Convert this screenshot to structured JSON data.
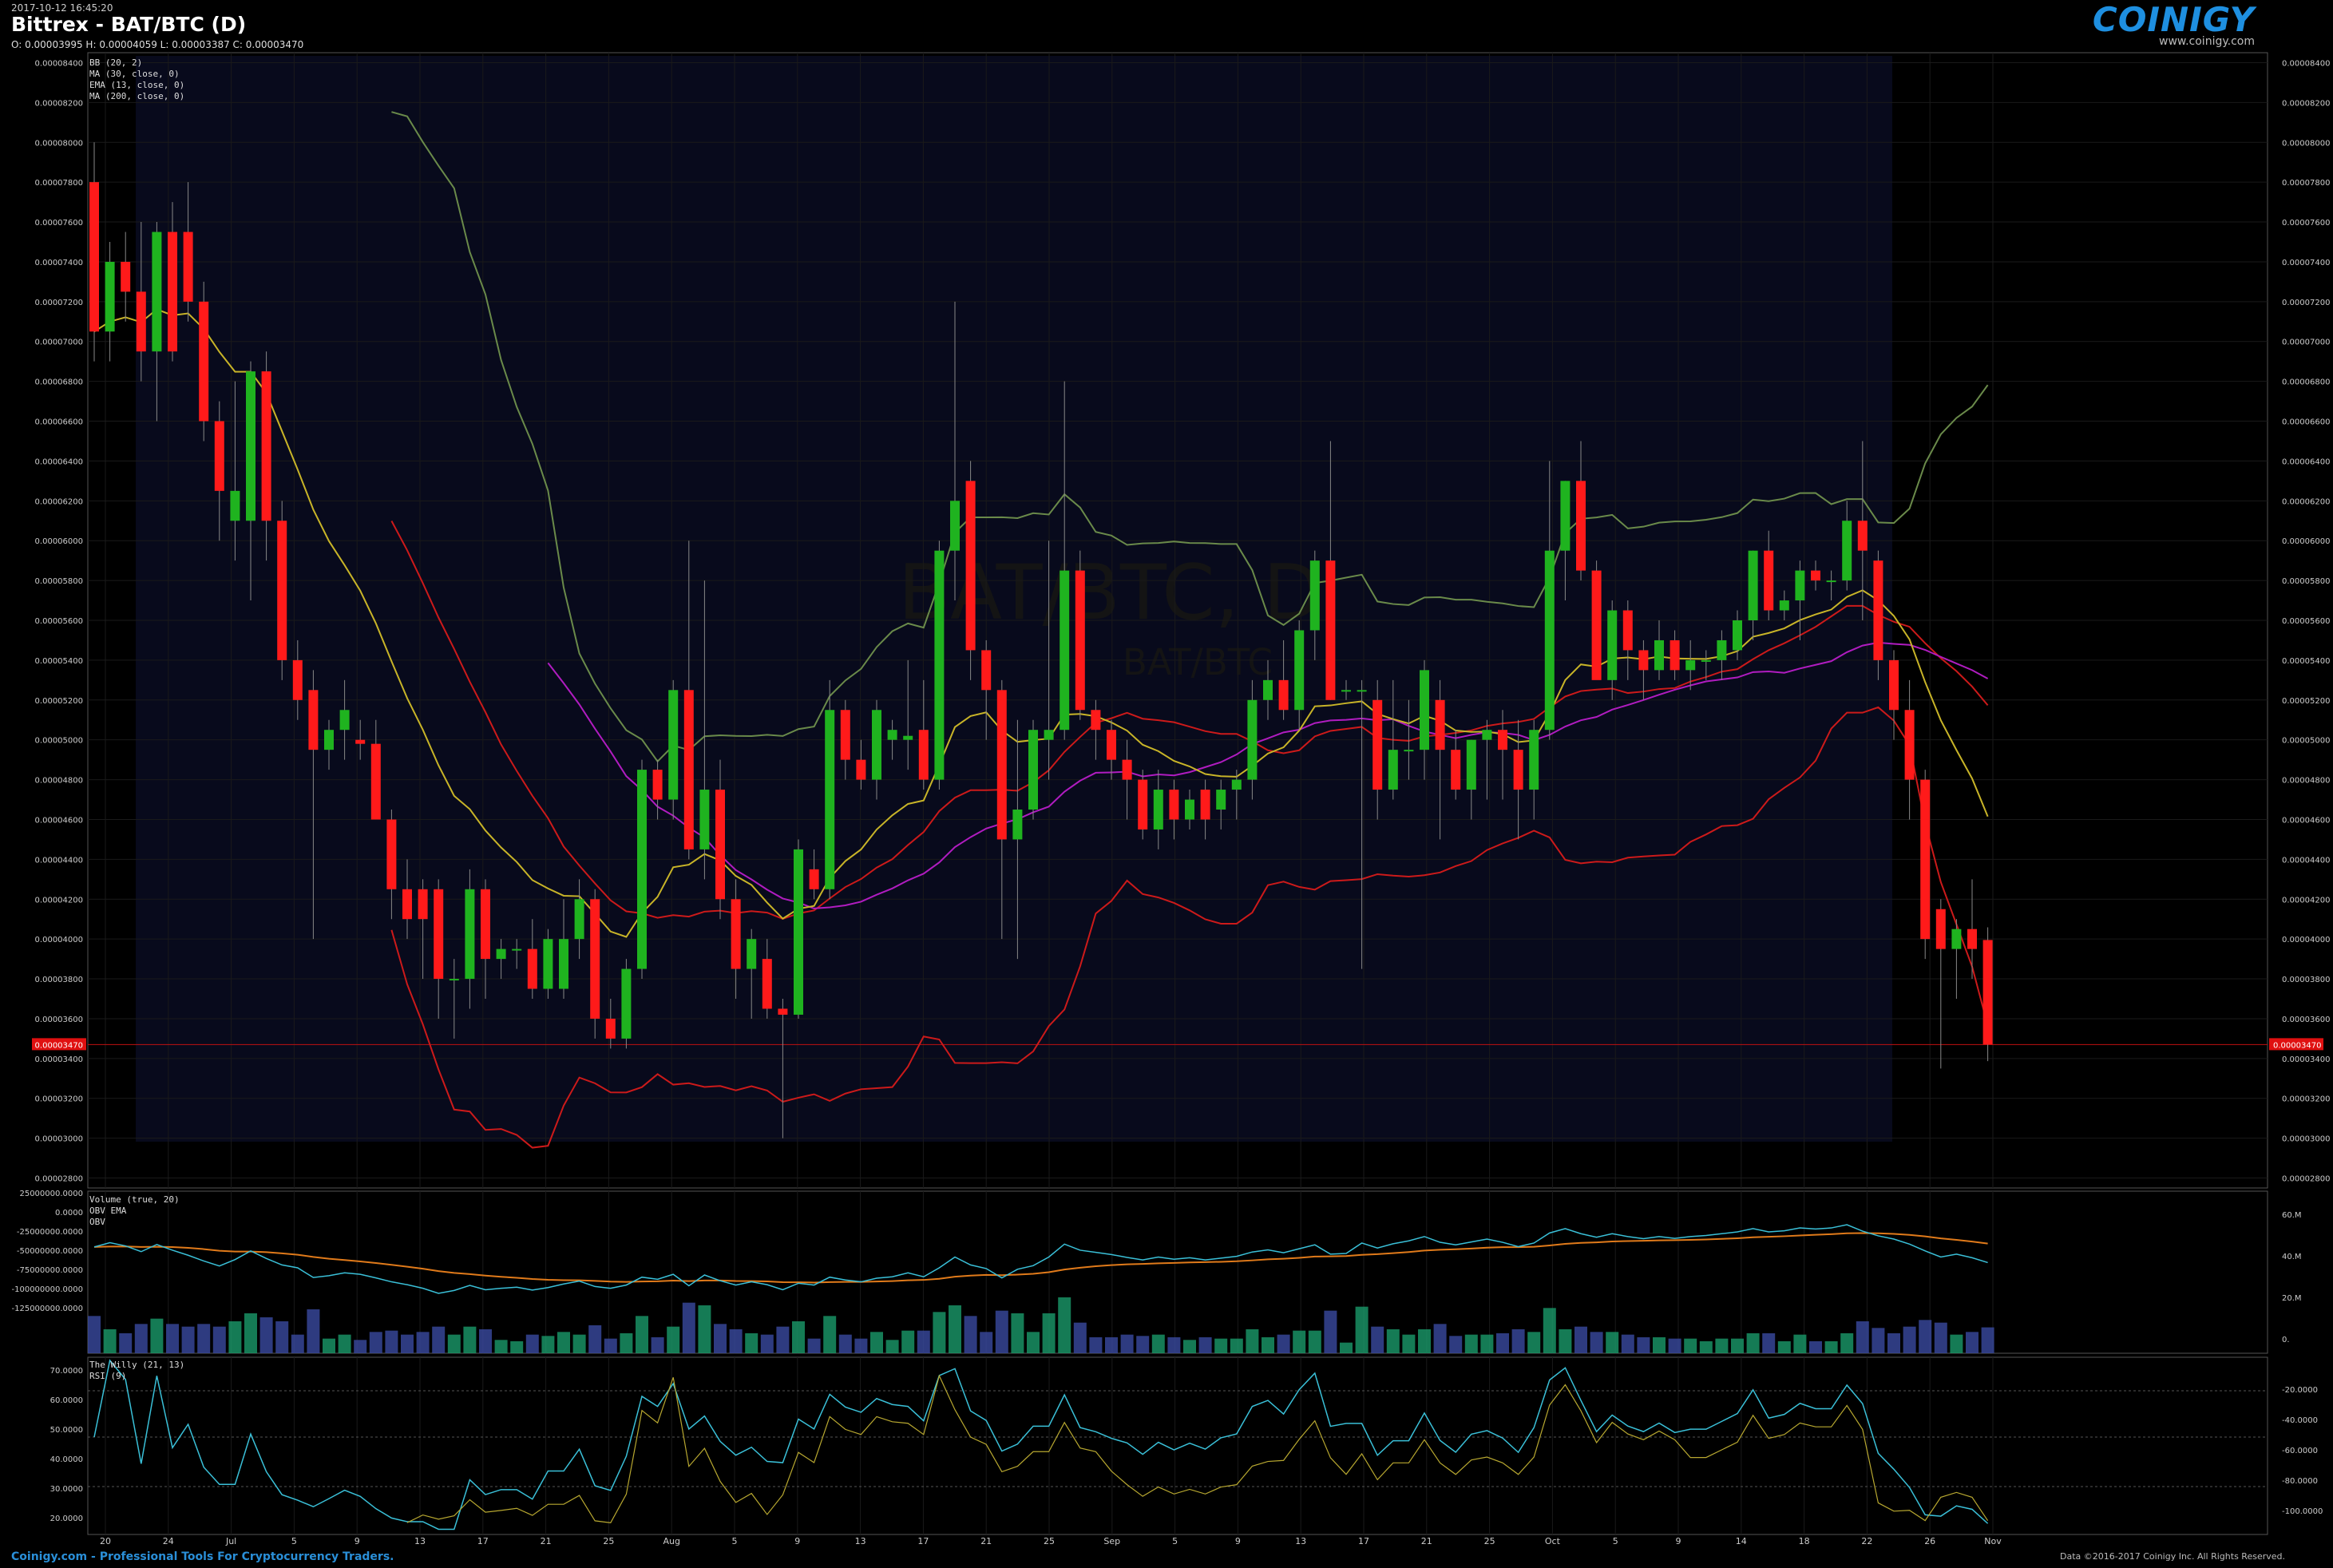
{
  "header": {
    "timestamp": "2017-10-12 16:45:20",
    "title": "Bittrex - BAT/BTC (D)",
    "ohlc": "O: 0.00003995 H: 0.00004059 L: 0.00003387 C: 0.00003470",
    "logo": "COINIGY",
    "site": "www.coinigy.com",
    "watermark": "BAT/BTC, D",
    "watermark_sub": "BAT/BTC"
  },
  "footer": {
    "tagline": "Coinigy.com - Professional Tools For Cryptocurrency Traders.",
    "copyright": "Data ©2016-2017 Coinigy Inc. All Rights Reserved."
  },
  "colors": {
    "up": "#1fb31f",
    "down": "#ff1a1a",
    "bb": "#6a8a4a",
    "ma30": "#b01cc0",
    "ema13": "#c8b428",
    "ma200": "#cc1a1a",
    "obv": "#3ac0d8",
    "obv_ema": "#e07a1a",
    "rsi": "#3ac0d8",
    "willy": "#b8a830"
  },
  "chart_data": [
    {
      "type": "candlestick",
      "title": "Bittrex - BAT/BTC (D)",
      "indicators_legend": [
        "BB (20, 2)",
        "MA (30, close, 0)",
        "EMA (13, close, 0)",
        "MA (200, close, 0)"
      ],
      "x_tick_labels": [
        "20",
        "24",
        "Jul",
        "5",
        "9",
        "13",
        "17",
        "21",
        "25",
        "Aug",
        "5",
        "9",
        "13",
        "17",
        "21",
        "25",
        "Sep",
        "5",
        "9",
        "13",
        "17",
        "21",
        "25",
        "Oct",
        "5",
        "9",
        "14",
        "18",
        "22",
        "26",
        "Nov"
      ],
      "y_tick_labels": [
        "0.00008400",
        "0.00008200",
        "0.00008000",
        "0.00007800",
        "0.00007600",
        "0.00007400",
        "0.00007200",
        "0.00007000",
        "0.00006800",
        "0.00006600",
        "0.00006400",
        "0.00006200",
        "0.00006000",
        "0.00005800",
        "0.00005600",
        "0.00005400",
        "0.00005200",
        "0.00005000",
        "0.00004800",
        "0.00004600",
        "0.00004400",
        "0.00004200",
        "0.00004000",
        "0.00003800",
        "0.00003600",
        "0.00003400",
        "0.00003200",
        "0.00003000",
        "0.00002800"
      ],
      "ylim": [
        2.75e-05,
        8.45e-05
      ],
      "current_price": "0.00003470",
      "candles": [
        {
          "o": 7.8,
          "h": 8.0,
          "l": 6.9,
          "c": 7.05
        },
        {
          "o": 7.05,
          "h": 7.5,
          "l": 6.9,
          "c": 7.4
        },
        {
          "o": 7.4,
          "h": 7.55,
          "l": 7.1,
          "c": 7.25
        },
        {
          "o": 7.25,
          "h": 7.6,
          "l": 6.8,
          "c": 6.95
        },
        {
          "o": 6.95,
          "h": 7.6,
          "l": 6.6,
          "c": 7.55
        },
        {
          "o": 7.55,
          "h": 7.7,
          "l": 6.9,
          "c": 6.95
        },
        {
          "o": 7.55,
          "h": 7.8,
          "l": 7.1,
          "c": 7.2
        },
        {
          "o": 7.2,
          "h": 7.3,
          "l": 6.5,
          "c": 6.6
        },
        {
          "o": 6.6,
          "h": 6.7,
          "l": 6.0,
          "c": 6.25
        },
        {
          "o": 6.1,
          "h": 6.8,
          "l": 5.9,
          "c": 6.25
        },
        {
          "o": 6.1,
          "h": 6.9,
          "l": 5.7,
          "c": 6.85
        },
        {
          "o": 6.85,
          "h": 6.95,
          "l": 5.9,
          "c": 6.1
        },
        {
          "o": 6.1,
          "h": 6.2,
          "l": 5.3,
          "c": 5.4
        },
        {
          "o": 5.4,
          "h": 5.5,
          "l": 5.1,
          "c": 5.2
        },
        {
          "o": 5.25,
          "h": 5.35,
          "l": 4.0,
          "c": 4.95
        },
        {
          "o": 4.95,
          "h": 5.1,
          "l": 4.85,
          "c": 5.05
        },
        {
          "o": 5.05,
          "h": 5.3,
          "l": 4.9,
          "c": 5.15
        },
        {
          "o": 5.0,
          "h": 5.1,
          "l": 4.9,
          "c": 4.98
        },
        {
          "o": 4.98,
          "h": 5.1,
          "l": 4.6,
          "c": 4.6
        },
        {
          "o": 4.6,
          "h": 4.65,
          "l": 4.1,
          "c": 4.25
        },
        {
          "o": 4.25,
          "h": 4.4,
          "l": 4.0,
          "c": 4.1
        },
        {
          "o": 4.25,
          "h": 4.3,
          "l": 3.8,
          "c": 4.1
        },
        {
          "o": 4.25,
          "h": 4.3,
          "l": 3.6,
          "c": 3.8
        },
        {
          "o": 3.8,
          "h": 3.9,
          "l": 3.5,
          "c": 3.8
        },
        {
          "o": 3.8,
          "h": 4.35,
          "l": 3.65,
          "c": 4.25
        },
        {
          "o": 4.25,
          "h": 4.3,
          "l": 3.7,
          "c": 3.9
        },
        {
          "o": 3.9,
          "h": 4.0,
          "l": 3.8,
          "c": 3.95
        },
        {
          "o": 3.95,
          "h": 4.0,
          "l": 3.85,
          "c": 3.95
        },
        {
          "o": 3.95,
          "h": 4.1,
          "l": 3.7,
          "c": 3.75
        },
        {
          "o": 3.75,
          "h": 4.05,
          "l": 3.7,
          "c": 4.0
        },
        {
          "o": 3.75,
          "h": 4.2,
          "l": 3.7,
          "c": 4.0
        },
        {
          "o": 4.0,
          "h": 4.3,
          "l": 3.9,
          "c": 4.2
        },
        {
          "o": 4.2,
          "h": 4.25,
          "l": 3.5,
          "c": 3.6
        },
        {
          "o": 3.6,
          "h": 3.7,
          "l": 3.45,
          "c": 3.5
        },
        {
          "o": 3.5,
          "h": 3.9,
          "l": 3.45,
          "c": 3.85
        },
        {
          "o": 3.85,
          "h": 4.9,
          "l": 3.8,
          "c": 4.85
        },
        {
          "o": 4.85,
          "h": 4.9,
          "l": 4.6,
          "c": 4.7
        },
        {
          "o": 4.7,
          "h": 5.3,
          "l": 4.6,
          "c": 5.25
        },
        {
          "o": 5.25,
          "h": 6.0,
          "l": 4.4,
          "c": 4.45
        },
        {
          "o": 4.45,
          "h": 5.8,
          "l": 4.3,
          "c": 4.75
        },
        {
          "o": 4.75,
          "h": 4.9,
          "l": 4.1,
          "c": 4.2
        },
        {
          "o": 4.2,
          "h": 4.3,
          "l": 3.7,
          "c": 3.85
        },
        {
          "o": 3.85,
          "h": 4.05,
          "l": 3.6,
          "c": 4.0
        },
        {
          "o": 3.9,
          "h": 4.0,
          "l": 3.6,
          "c": 3.65
        },
        {
          "o": 3.65,
          "h": 3.7,
          "l": 3.0,
          "c": 3.62
        },
        {
          "o": 3.62,
          "h": 4.5,
          "l": 3.6,
          "c": 4.45
        },
        {
          "o": 4.35,
          "h": 4.45,
          "l": 4.2,
          "c": 4.25
        },
        {
          "o": 4.25,
          "h": 5.3,
          "l": 4.2,
          "c": 5.15
        },
        {
          "o": 5.15,
          "h": 5.2,
          "l": 4.8,
          "c": 4.9
        },
        {
          "o": 4.9,
          "h": 5.0,
          "l": 4.75,
          "c": 4.8
        },
        {
          "o": 4.8,
          "h": 5.2,
          "l": 4.7,
          "c": 5.15
        },
        {
          "o": 5.0,
          "h": 5.1,
          "l": 4.9,
          "c": 5.05
        },
        {
          "o": 5.0,
          "h": 5.4,
          "l": 4.85,
          "c": 5.02
        },
        {
          "o": 5.05,
          "h": 5.3,
          "l": 4.75,
          "c": 4.8
        },
        {
          "o": 4.8,
          "h": 6.0,
          "l": 4.75,
          "c": 5.95
        },
        {
          "o": 5.95,
          "h": 7.2,
          "l": 5.7,
          "c": 6.2
        },
        {
          "o": 6.3,
          "h": 6.4,
          "l": 5.3,
          "c": 5.45
        },
        {
          "o": 5.45,
          "h": 5.5,
          "l": 5.0,
          "c": 5.25
        },
        {
          "o": 5.25,
          "h": 5.3,
          "l": 4.0,
          "c": 4.5
        },
        {
          "o": 4.5,
          "h": 5.1,
          "l": 3.9,
          "c": 4.65
        },
        {
          "o": 4.65,
          "h": 5.1,
          "l": 4.6,
          "c": 5.05
        },
        {
          "o": 5.0,
          "h": 6.0,
          "l": 4.8,
          "c": 5.05
        },
        {
          "o": 5.05,
          "h": 6.8,
          "l": 5.0,
          "c": 5.85
        },
        {
          "o": 5.85,
          "h": 5.95,
          "l": 5.1,
          "c": 5.15
        },
        {
          "o": 5.15,
          "h": 5.2,
          "l": 4.9,
          "c": 5.05
        },
        {
          "o": 5.05,
          "h": 5.1,
          "l": 4.8,
          "c": 4.9
        },
        {
          "o": 4.9,
          "h": 5.0,
          "l": 4.6,
          "c": 4.8
        },
        {
          "o": 4.8,
          "h": 4.85,
          "l": 4.5,
          "c": 4.55
        },
        {
          "o": 4.55,
          "h": 4.85,
          "l": 4.45,
          "c": 4.75
        },
        {
          "o": 4.75,
          "h": 4.8,
          "l": 4.5,
          "c": 4.6
        },
        {
          "o": 4.6,
          "h": 4.75,
          "l": 4.55,
          "c": 4.7
        },
        {
          "o": 4.75,
          "h": 4.8,
          "l": 4.5,
          "c": 4.6
        },
        {
          "o": 4.65,
          "h": 4.8,
          "l": 4.55,
          "c": 4.75
        },
        {
          "o": 4.75,
          "h": 4.85,
          "l": 4.6,
          "c": 4.8
        },
        {
          "o": 4.8,
          "h": 5.3,
          "l": 4.7,
          "c": 5.2
        },
        {
          "o": 5.2,
          "h": 5.4,
          "l": 5.1,
          "c": 5.3
        },
        {
          "o": 5.3,
          "h": 5.5,
          "l": 5.1,
          "c": 5.15
        },
        {
          "o": 5.15,
          "h": 5.6,
          "l": 5.05,
          "c": 5.55
        },
        {
          "o": 5.55,
          "h": 5.95,
          "l": 5.4,
          "c": 5.9
        },
        {
          "o": 5.9,
          "h": 6.5,
          "l": 5.2,
          "c": 5.2
        },
        {
          "o": 5.25,
          "h": 5.3,
          "l": 5.2,
          "c": 5.25
        },
        {
          "o": 5.25,
          "h": 5.3,
          "l": 3.85,
          "c": 5.25
        },
        {
          "o": 5.2,
          "h": 5.3,
          "l": 4.6,
          "c": 4.75
        },
        {
          "o": 4.75,
          "h": 5.3,
          "l": 4.7,
          "c": 4.95
        },
        {
          "o": 4.95,
          "h": 5.2,
          "l": 4.8,
          "c": 4.95
        },
        {
          "o": 4.95,
          "h": 5.4,
          "l": 4.8,
          "c": 5.35
        },
        {
          "o": 5.2,
          "h": 5.3,
          "l": 4.5,
          "c": 4.95
        },
        {
          "o": 4.95,
          "h": 5.05,
          "l": 4.7,
          "c": 4.75
        },
        {
          "o": 4.75,
          "h": 5.0,
          "l": 4.6,
          "c": 5.0
        },
        {
          "o": 5.0,
          "h": 5.1,
          "l": 4.7,
          "c": 5.05
        },
        {
          "o": 5.05,
          "h": 5.15,
          "l": 4.7,
          "c": 4.95
        },
        {
          "o": 4.95,
          "h": 5.1,
          "l": 4.5,
          "c": 4.75
        },
        {
          "o": 4.75,
          "h": 5.1,
          "l": 4.6,
          "c": 5.05
        },
        {
          "o": 5.05,
          "h": 6.4,
          "l": 5.0,
          "c": 5.95
        },
        {
          "o": 5.95,
          "h": 6.3,
          "l": 5.7,
          "c": 6.3
        },
        {
          "o": 6.3,
          "h": 6.5,
          "l": 5.8,
          "c": 5.85
        },
        {
          "o": 5.85,
          "h": 5.9,
          "l": 5.4,
          "c": 5.3
        },
        {
          "o": 5.3,
          "h": 5.7,
          "l": 5.2,
          "c": 5.65
        },
        {
          "o": 5.65,
          "h": 5.7,
          "l": 5.3,
          "c": 5.45
        },
        {
          "o": 5.45,
          "h": 5.5,
          "l": 5.2,
          "c": 5.35
        },
        {
          "o": 5.35,
          "h": 5.6,
          "l": 5.3,
          "c": 5.5
        },
        {
          "o": 5.5,
          "h": 5.55,
          "l": 5.3,
          "c": 5.35
        },
        {
          "o": 5.35,
          "h": 5.5,
          "l": 5.25,
          "c": 5.4
        },
        {
          "o": 5.4,
          "h": 5.45,
          "l": 5.3,
          "c": 5.4
        },
        {
          "o": 5.4,
          "h": 5.55,
          "l": 5.3,
          "c": 5.5
        },
        {
          "o": 5.45,
          "h": 5.65,
          "l": 5.4,
          "c": 5.6
        },
        {
          "o": 5.6,
          "h": 5.95,
          "l": 5.5,
          "c": 5.95
        },
        {
          "o": 5.95,
          "h": 6.05,
          "l": 5.6,
          "c": 5.65
        },
        {
          "o": 5.65,
          "h": 5.75,
          "l": 5.6,
          "c": 5.7
        },
        {
          "o": 5.7,
          "h": 5.9,
          "l": 5.5,
          "c": 5.85
        },
        {
          "o": 5.85,
          "h": 5.9,
          "l": 5.75,
          "c": 5.8
        },
        {
          "o": 5.8,
          "h": 5.85,
          "l": 5.7,
          "c": 5.8
        },
        {
          "o": 5.8,
          "h": 6.2,
          "l": 5.75,
          "c": 6.1
        },
        {
          "o": 6.1,
          "h": 6.5,
          "l": 5.6,
          "c": 5.95
        },
        {
          "o": 5.9,
          "h": 5.95,
          "l": 5.3,
          "c": 5.4
        },
        {
          "o": 5.4,
          "h": 5.45,
          "l": 5.0,
          "c": 5.15
        },
        {
          "o": 5.15,
          "h": 5.3,
          "l": 4.6,
          "c": 4.8
        },
        {
          "o": 4.8,
          "h": 4.85,
          "l": 3.9,
          "c": 4.0
        },
        {
          "o": 4.15,
          "h": 4.2,
          "l": 3.35,
          "c": 3.95
        },
        {
          "o": 3.95,
          "h": 4.1,
          "l": 3.7,
          "c": 4.05
        },
        {
          "o": 4.05,
          "h": 4.3,
          "l": 3.8,
          "c": 3.95
        },
        {
          "o": 3.995,
          "h": 4.059,
          "l": 3.387,
          "c": 3.47
        }
      ],
      "volume_panel": {
        "legend": [
          "Volume (true, 20)",
          "OBV EMA",
          "OBV"
        ],
        "left_tick_labels": [
          "25000000.0000",
          "0.0000",
          "-25000000.0000",
          "-50000000.0000",
          "-75000000.0000",
          "-100000000.0000",
          "-125000000.0000"
        ],
        "right_tick_labels": [
          "60.M",
          "40.M",
          "20.M",
          "0."
        ]
      },
      "oscillator_panel": {
        "legend": [
          "The Willy (21, 13)",
          "RSI (9)"
        ],
        "left_tick_labels": [
          "70.0000",
          "60.0000",
          "50.0000",
          "40.0000",
          "30.0000",
          "20.0000"
        ],
        "right_tick_labels": [
          "-20.0000",
          "-40.0000",
          "-60.0000",
          "-80.0000",
          "-100.0000"
        ]
      }
    }
  ]
}
